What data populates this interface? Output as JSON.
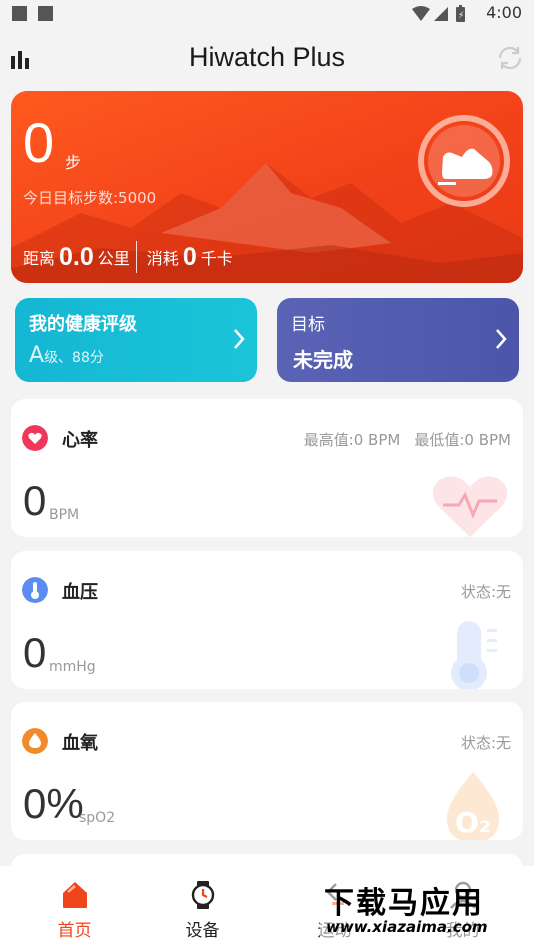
{
  "status_bar": {
    "time": "4:00"
  },
  "header": {
    "title": "Hiwatch Plus"
  },
  "steps_card": {
    "value": "0",
    "unit": "步",
    "goal": "今日目标步数:5000",
    "distance_label": "距离",
    "distance_value": "0.0",
    "distance_unit": "公里",
    "calories_label": "消耗",
    "calories_value": "0",
    "calories_unit": "千卡",
    "accent_color": "#f2421a"
  },
  "health_card": {
    "title": "我的健康评级",
    "grade": "A",
    "grade_suffix": "级、88分"
  },
  "goal_card": {
    "title": "目标",
    "status": "未完成"
  },
  "metrics": [
    {
      "name": "心率",
      "max": "最高值:0 BPM",
      "min": "最低值:0 BPM",
      "value": "0",
      "unit": "BPM",
      "icon": "heart-icon",
      "color": "#f0365a"
    },
    {
      "name": "血压",
      "status": "状态:无",
      "value": "0",
      "unit": "mmHg",
      "icon": "thermometer-icon",
      "color": "#5a8def"
    },
    {
      "name": "血氧",
      "status": "状态:无",
      "value": "0%",
      "unit": "spO2",
      "icon": "oxygen-drop-icon",
      "color": "#f08a2a"
    }
  ],
  "tabs": [
    {
      "label": "首页",
      "icon": "home-icon",
      "active": true
    },
    {
      "label": "设备",
      "icon": "watch-icon",
      "active": false
    },
    {
      "label": "运动",
      "icon": "sport-icon",
      "active": false
    },
    {
      "label": "我的",
      "icon": "profile-icon",
      "active": false
    }
  ],
  "watermark": {
    "text_cn": "下载马应用",
    "url": "www.xiazaima.com"
  }
}
